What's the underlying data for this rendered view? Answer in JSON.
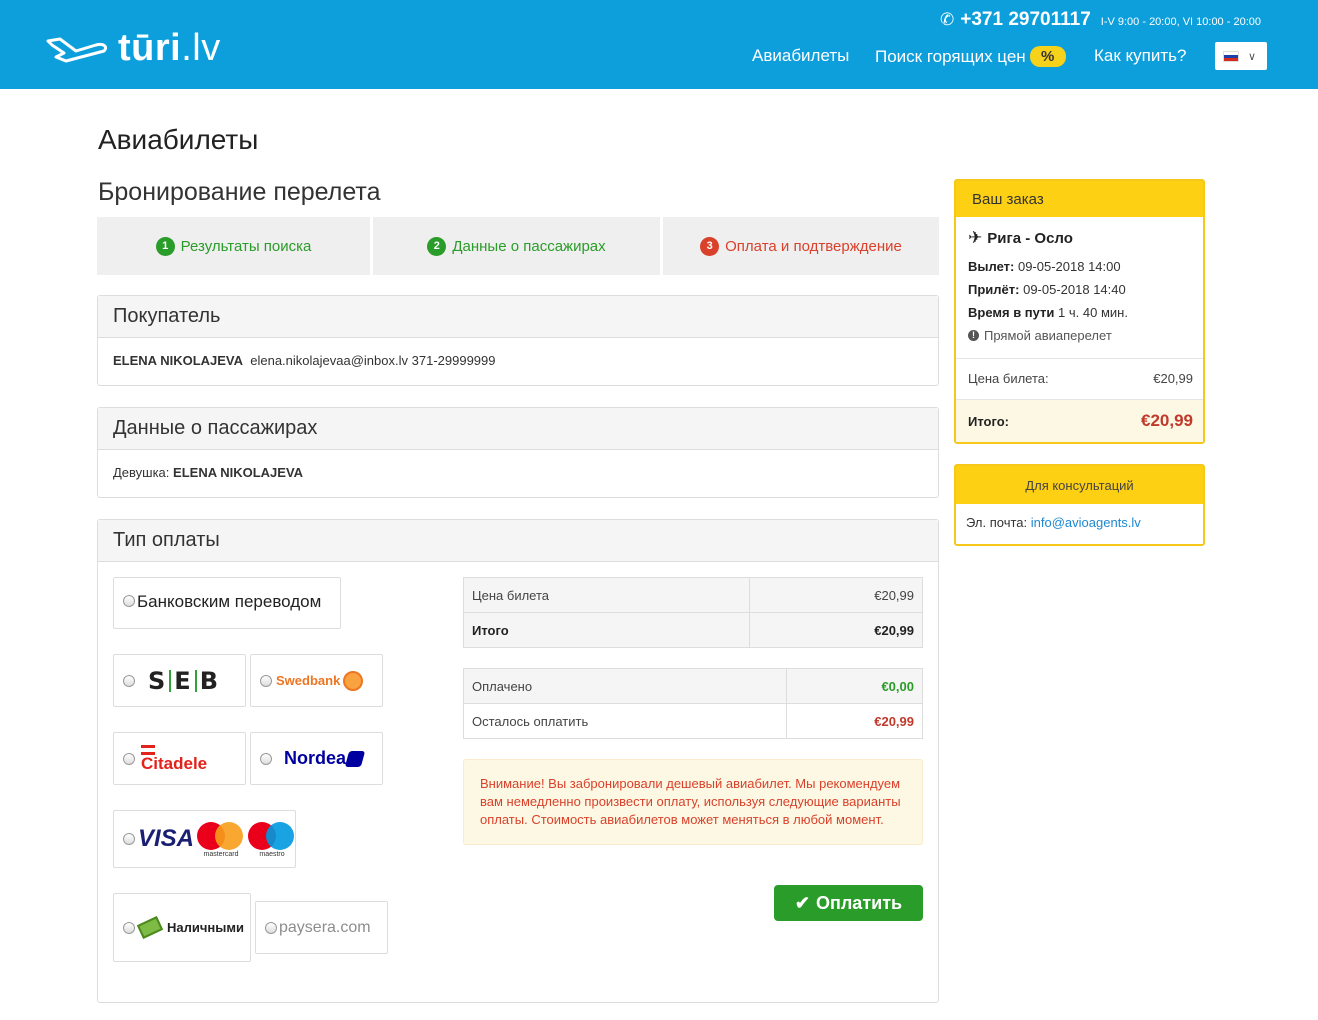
{
  "header": {
    "logo_text_bold": "tūri",
    "logo_text_rest": ".lv",
    "phone_number": "+371 29701117",
    "phone_hours": "I-V 9:00 - 20:00, VI 10:00 - 20:00",
    "nav": {
      "tickets": "Авиабилеты",
      "hot_prices": "Поиск горящих цен",
      "hot_badge": "%",
      "how_to_buy": "Как купить?"
    },
    "language": "ru"
  },
  "page": {
    "title": "Авиабилеты",
    "subtitle": "Бронирование перелета"
  },
  "steps": [
    {
      "num": "1",
      "label": "Результаты поиска",
      "state": "done"
    },
    {
      "num": "2",
      "label": "Данные о пассажирах",
      "state": "done"
    },
    {
      "num": "3",
      "label": "Оплата и подтверждение",
      "state": "active"
    }
  ],
  "buyer": {
    "heading": "Покупатель",
    "name": "ELENA NIKOLAJEVA",
    "email": "elena.nikolajevaa@inbox.lv",
    "phone": "371-29999999"
  },
  "passengers": {
    "heading": "Данные о пассажирах",
    "title_label": "Девушка:",
    "name": "ELENA NIKOLAJEVA"
  },
  "payment": {
    "heading": "Тип оплаты",
    "bank_transfer": "Банковским переводом",
    "options": {
      "seb_left": "S",
      "seb_mid": "E",
      "seb_right": "B",
      "swedbank": "Swedbank",
      "citadele": "Citadele",
      "nordea": "Nordea",
      "visa": "VISA",
      "mastercard": "mastercard",
      "maestro": "maestro",
      "cash": "Наличными",
      "paysera": "paysera.com"
    },
    "price_table": {
      "ticket_label": "Цена билета",
      "ticket_value": "€20,99",
      "total_label": "Итого",
      "total_value": "€20,99"
    },
    "paid_table": {
      "paid_label": "Оплачено",
      "paid_value": "€0,00",
      "remaining_label": "Осталось оплатить",
      "remaining_value": "€20,99"
    },
    "warning": "Внимание! Вы забронировали дешевый авиабилет. Мы рекомендуем вам немедленно произвести оплату, используя следующие варианты оплаты. Стоимость авиабилетов может меняться в любой момент.",
    "pay_button": "Оплатить"
  },
  "order": {
    "heading": "Ваш заказ",
    "route": "Рига - Осло",
    "departure_label": "Вылет:",
    "departure_value": "09-05-2018 14:00",
    "arrival_label": "Прилёт:",
    "arrival_value": "09-05-2018 14:40",
    "duration_label": "Время в пути",
    "duration_value": "1 ч. 40 мин.",
    "direct": "Прямой авиаперелет",
    "ticket_price_label": "Цена билета:",
    "ticket_price_value": "€20,99",
    "total_label": "Итого:",
    "total_value": "€20,99"
  },
  "consult": {
    "heading": "Для консультаций",
    "email_label": "Эл. почта:",
    "email_value": "info@avioagents.lv"
  },
  "colors": {
    "header_bg": "#0d9fdc",
    "accent_yellow": "#fed014",
    "success_green": "#2a9c29",
    "danger_red": "#d9412b"
  }
}
